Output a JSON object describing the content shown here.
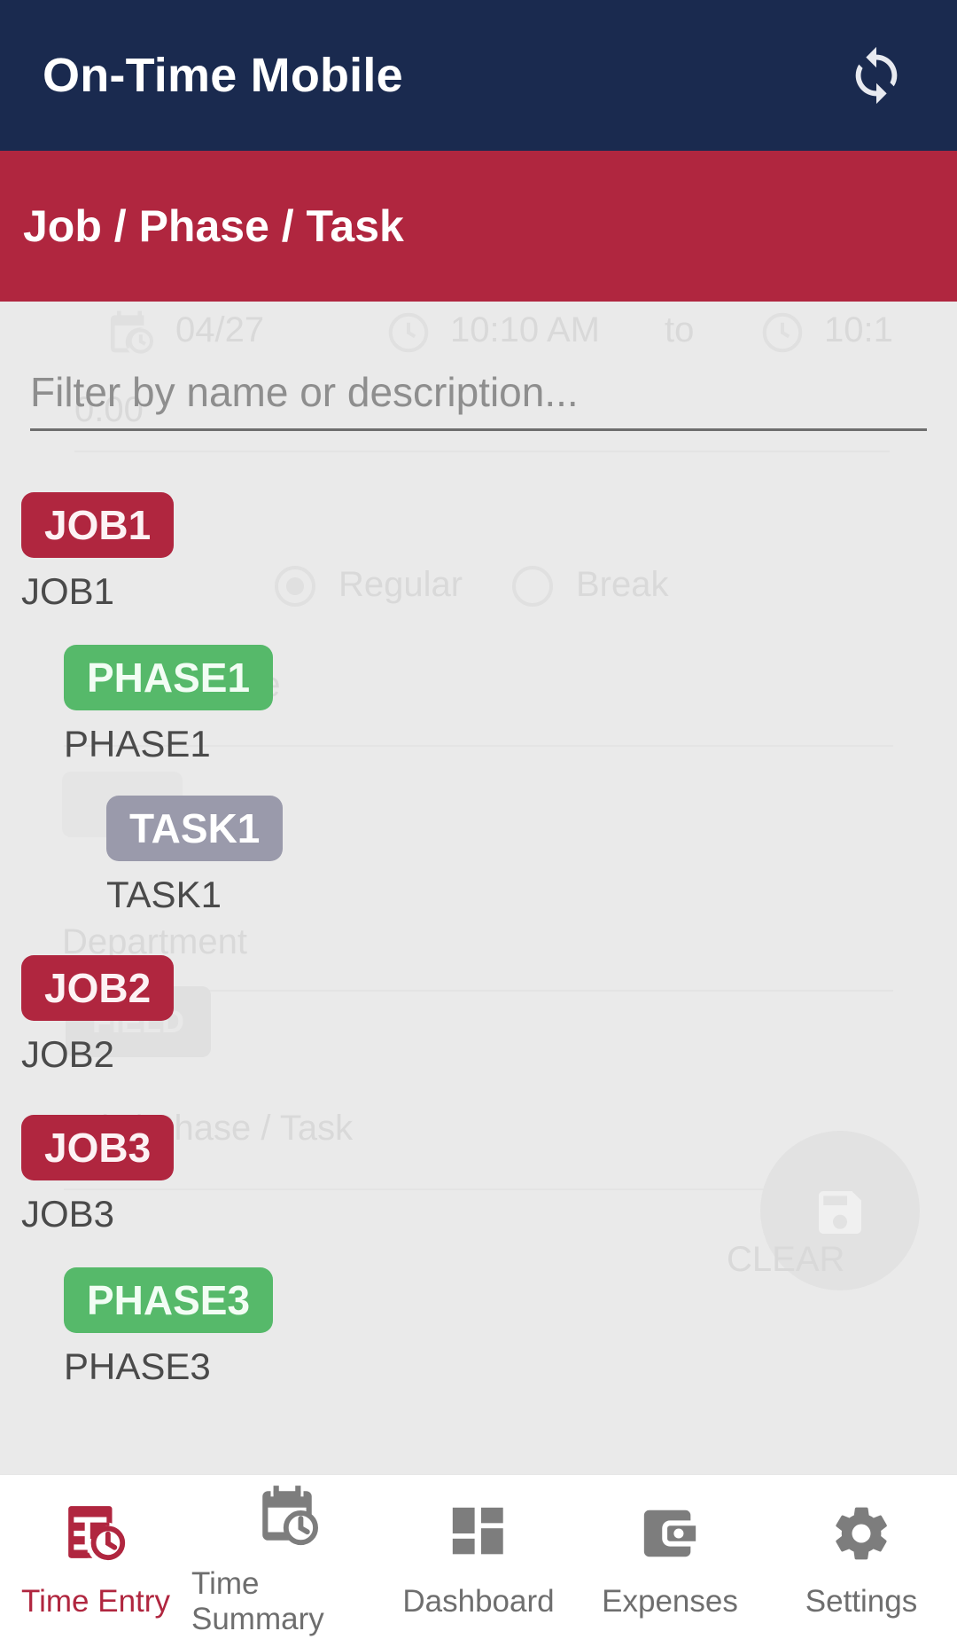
{
  "app": {
    "title": "On-Time Mobile",
    "accent_navy": "#1a2a4f",
    "accent_crimson": "#b0263f",
    "accent_green": "#56b96a",
    "accent_gray": "#9a9aab",
    "background": "#eaeaea"
  },
  "appbar": {
    "title": "On-Time Mobile",
    "sync_icon": "sync-icon"
  },
  "subheader": {
    "title": "Job / Phase / Task"
  },
  "filter": {
    "value": "",
    "placeholder": "Filter by name or description..."
  },
  "tree": {
    "nodes": [
      {
        "code": "JOB1",
        "label": "JOB1",
        "level": "job"
      },
      {
        "code": "PHASE1",
        "label": "PHASE1",
        "level": "phase"
      },
      {
        "code": "TASK1",
        "label": "TASK1",
        "level": "task"
      },
      {
        "code": "JOB2",
        "label": "JOB2",
        "level": "job"
      },
      {
        "code": "JOB3",
        "label": "JOB3",
        "level": "job"
      },
      {
        "code": "PHASE3",
        "label": "PHASE3",
        "level": "phase"
      }
    ]
  },
  "ghost": {
    "date": "04/27",
    "time_start": "10:10 AM",
    "time_to": "to",
    "time_end": "10:1",
    "hours": "0.00",
    "radio_regular": "Regular",
    "radio_break": "Break",
    "code_label": "de",
    "department_label": "Department",
    "field_chip": "FIELD",
    "job_phase_task": "Job / Phase / Task",
    "clear_label": "CLEAR"
  },
  "bottomnav": {
    "items": [
      {
        "label": "Time Entry",
        "icon": "time-entry-icon",
        "active": true
      },
      {
        "label": "Time Summary",
        "icon": "time-summary-icon",
        "active": false
      },
      {
        "label": "Dashboard",
        "icon": "dashboard-icon",
        "active": false
      },
      {
        "label": "Expenses",
        "icon": "expenses-icon",
        "active": false
      },
      {
        "label": "Settings",
        "icon": "settings-icon",
        "active": false
      }
    ]
  }
}
